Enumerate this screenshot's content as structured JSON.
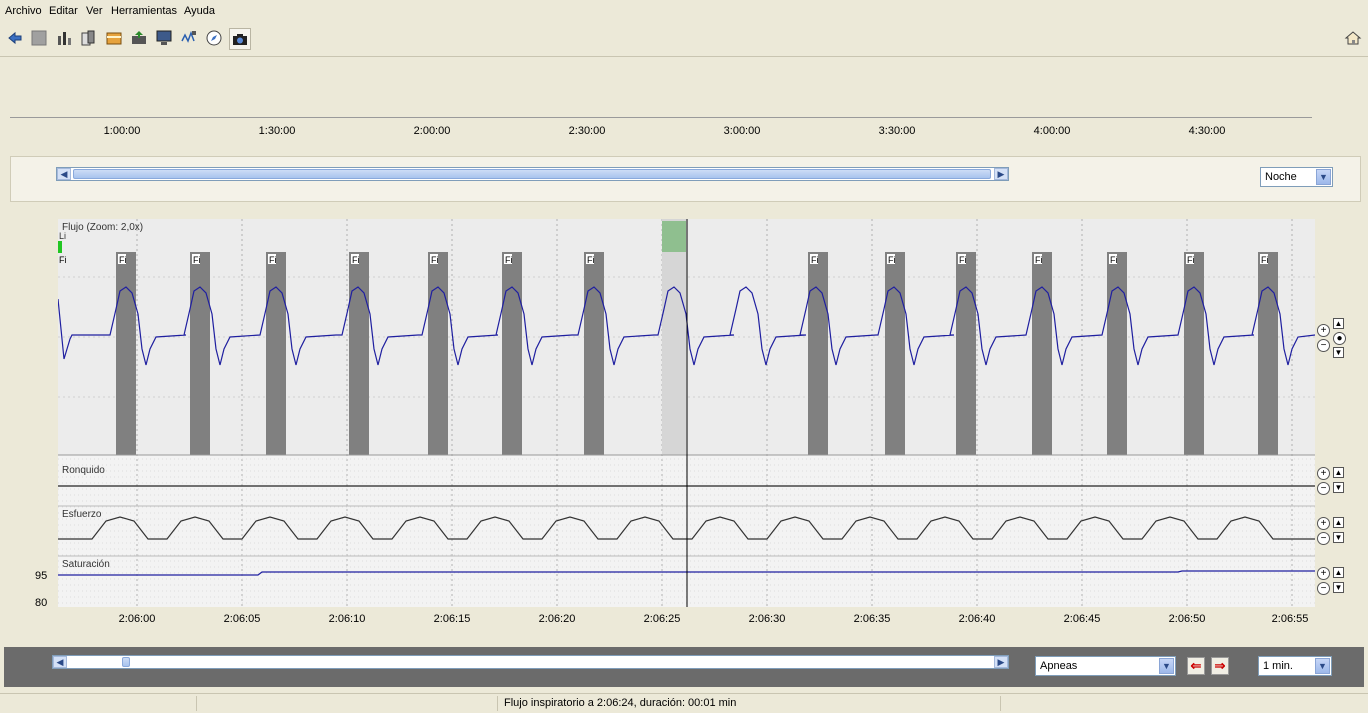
{
  "menu": {
    "items": [
      "Archivo",
      "Editar",
      "Ver",
      "Herramientas",
      "Ayuda"
    ]
  },
  "toolbar": {
    "icons": [
      "back-arrow-icon",
      "stop-icon",
      "tools-icon",
      "data-icon",
      "folder-icon",
      "export-icon",
      "monitor-icon",
      "signal-icon",
      "compass-icon",
      "camera-icon"
    ],
    "home_icon": "home-icon"
  },
  "overview": {
    "ticks": [
      "1:00:00",
      "1:30:00",
      "2:00:00",
      "2:30:00",
      "3:00:00",
      "3:30:00",
      "4:00:00",
      "4:30:00"
    ]
  },
  "top_panel": {
    "view_select": "Noche"
  },
  "channels": {
    "flujo": {
      "label": "Flujo (Zoom: 2,0x)",
      "event_tag": "Fi",
      "small_tag": "Li"
    },
    "ronquido": {
      "label": "Ronquido"
    },
    "esfuerzo": {
      "label": "Esfuerzo"
    },
    "saturacion": {
      "label": "Saturación",
      "axis_top": "95",
      "axis_bottom": "80"
    }
  },
  "time_axis": {
    "labels": [
      "2:06:00",
      "2:06:05",
      "2:06:10",
      "2:06:15",
      "2:06:20",
      "2:06:25",
      "2:06:30",
      "2:06:35",
      "2:06:40",
      "2:06:45",
      "2:06:50",
      "2:06:55"
    ]
  },
  "bottom_panel": {
    "event_select": "Apneas",
    "window_select": "1 min."
  },
  "status": {
    "message": "Flujo inspiratorio a 2:06:24, duración: 00:01 min"
  },
  "colors": {
    "waveform": "#1f1fa0",
    "event_bar": "#808080",
    "selected_event": "#8fbf8f",
    "cursor": "#000000"
  }
}
